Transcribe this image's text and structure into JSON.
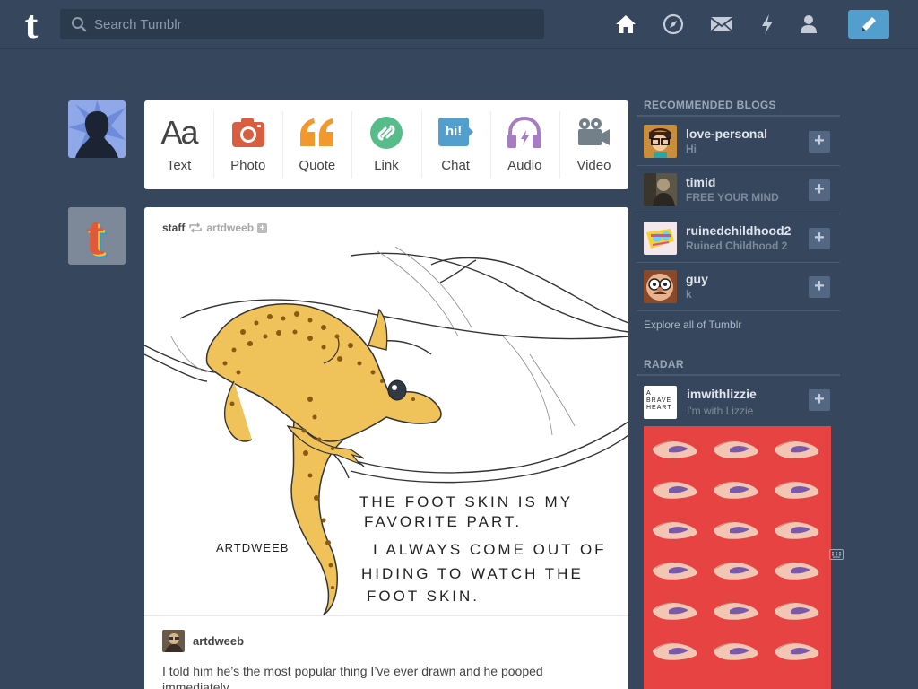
{
  "header": {
    "search_placeholder": "Search Tumblr",
    "logo_letter": "t",
    "nav": [
      "home-icon",
      "explore-icon",
      "inbox-icon",
      "activity-icon",
      "account-icon"
    ],
    "compose_icon": "pencil-icon"
  },
  "post_types": [
    {
      "label": "Text",
      "glyph": "Aa",
      "color": "#444444"
    },
    {
      "label": "Photo",
      "color": "#d95e40"
    },
    {
      "label": "Quote",
      "glyph": "“",
      "color": "#f2992e"
    },
    {
      "label": "Link",
      "color": "#56bc8a"
    },
    {
      "label": "Chat",
      "glyph": "hi!",
      "color": "#529ecc"
    },
    {
      "label": "Audio",
      "color": "#a77dc2"
    },
    {
      "label": "Video",
      "color": "#748089"
    }
  ],
  "post": {
    "author": "staff",
    "reblogged_from": "artdweeb",
    "art_text": {
      "signature": "ARTDWEEB",
      "line1": "THE FOOT SKIN IS MY",
      "line2": "FAVORITE PART.",
      "line3": "I ALWAYS COME OUT OF",
      "line4": "HIDING TO WATCH THE",
      "line5": "FOOT SKIN."
    },
    "reblogger": "artdweeb",
    "body": "I told him he’s the most popular thing I’ve ever drawn and he pooped immediately."
  },
  "sidebar": {
    "recommended_title": "RECOMMENDED BLOGS",
    "blogs": [
      {
        "name": "love-personal",
        "subtitle": "Hi"
      },
      {
        "name": "timid",
        "subtitle": "FREE YOUR MIND"
      },
      {
        "name": "ruinedchildhood2",
        "subtitle": "Ruined Childhood 2"
      },
      {
        "name": "guy",
        "subtitle": "k"
      }
    ],
    "explore_link": "Explore all of Tumblr",
    "radar_title": "RADAR",
    "radar_blog": {
      "name": "imwithlizzie",
      "subtitle": "I'm with Lizzie",
      "avatar_text": "A BRAVE HEART"
    }
  },
  "colors": {
    "background": "#36465d",
    "accent": "#529ecc",
    "radar_bg": "#e84343"
  }
}
